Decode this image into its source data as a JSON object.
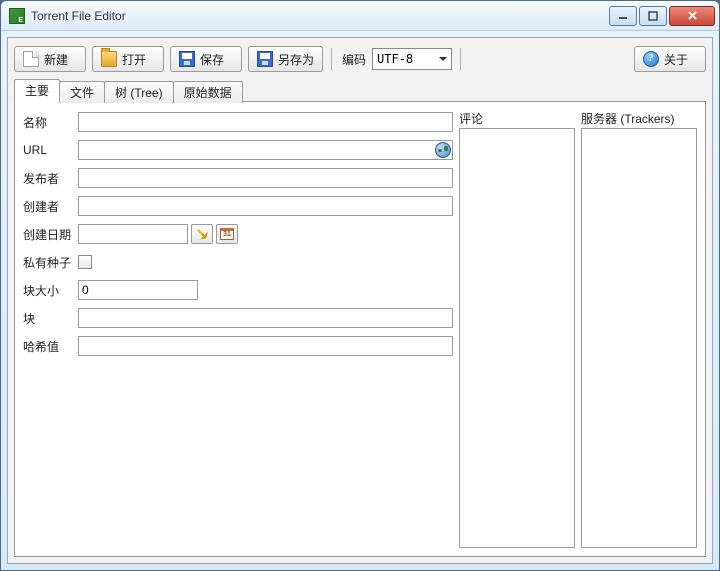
{
  "window": {
    "title": "Torrent File Editor"
  },
  "toolbar": {
    "new_label": "新建",
    "open_label": "打开",
    "save_label": "保存",
    "saveas_label": "另存为",
    "encoding_label": "编码",
    "encoding_value": "UTF-8",
    "about_label": "关于"
  },
  "tabs": {
    "main": "主要",
    "file": "文件",
    "tree": "树 (Tree)",
    "raw": "原始数据"
  },
  "fields": {
    "name_label": "名称",
    "url_label": "URL",
    "publisher_label": "发布者",
    "creator_label": "创建者",
    "created_label": "创建日期",
    "private_label": "私有种子",
    "piecesize_label": "块大小",
    "piecesize_value": "0",
    "pieces_label": "块",
    "hash_label": "哈希值",
    "name_value": "",
    "url_value": "",
    "publisher_value": "",
    "creator_value": "",
    "created_value": "",
    "pieces_value": "",
    "hash_value": ""
  },
  "panels": {
    "comments_label": "评论",
    "trackers_label": "服务器 (Trackers)"
  }
}
